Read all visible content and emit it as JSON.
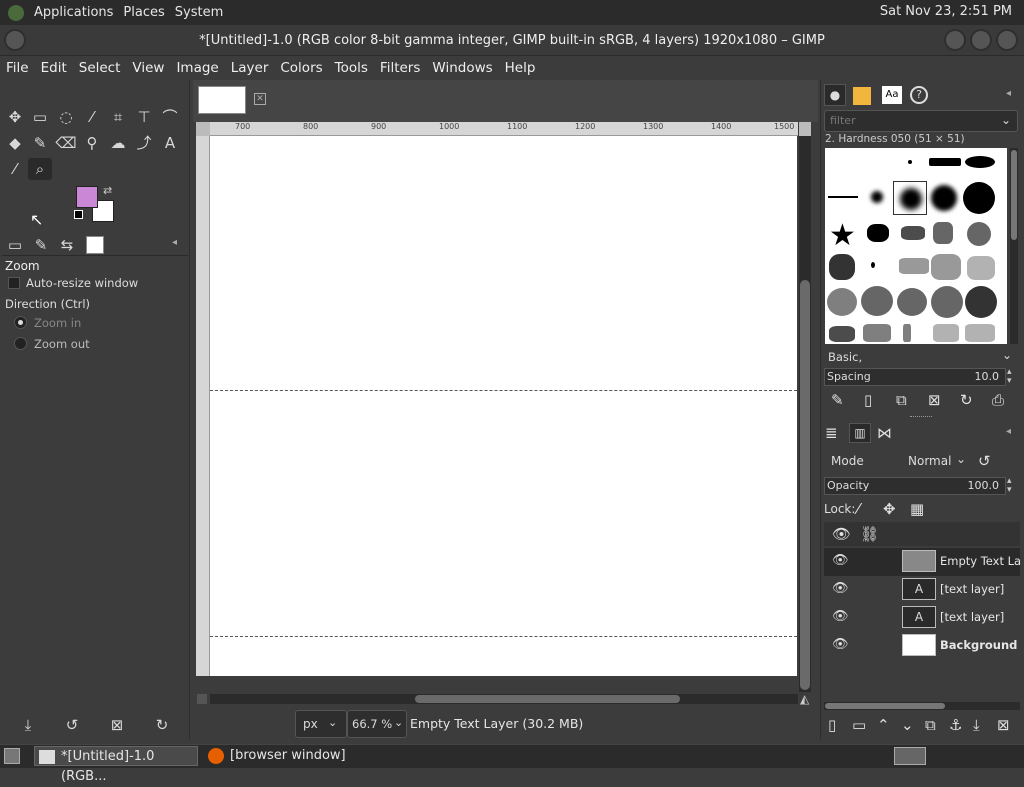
{
  "topbar": {
    "applications": "Applications",
    "places": "Places",
    "system": "System",
    "clock": "Sat Nov 23,  2:51 PM"
  },
  "window": {
    "title": "*[Untitled]-1.0 (RGB color 8-bit gamma integer, GIMP built-in sRGB, 4 layers) 1920x1080 – GIMP"
  },
  "menu": [
    "File",
    "Edit",
    "Select",
    "View",
    "Image",
    "Layer",
    "Colors",
    "Tools",
    "Filters",
    "Windows",
    "Help"
  ],
  "tool_options": {
    "title": "Zoom",
    "auto_resize": "Auto-resize window",
    "direction_label": "Direction  (Ctrl)",
    "zoom_in": "Zoom in",
    "zoom_out": "Zoom out"
  },
  "ruler_ticks": [
    "700",
    "800",
    "900",
    "1000",
    "1100",
    "1200",
    "1300",
    "1400",
    "1500"
  ],
  "statusbar": {
    "unit": "px",
    "zoom": "66.7 %",
    "message": "Empty Text Layer (30.2 MB)"
  },
  "brushes": {
    "filter_placeholder": "filter",
    "selected": "2. Hardness 050 (51 × 51)",
    "preset": "Basic,",
    "spacing_label": "Spacing",
    "spacing_value": "10.0"
  },
  "layers": {
    "mode_label": "Mode",
    "mode_value": "Normal",
    "opacity_label": "Opacity",
    "opacity_value": "100.0",
    "lock_label": "Lock:",
    "items": [
      {
        "name": "Empty Text Layer"
      },
      {
        "name": "[text layer]"
      },
      {
        "name": "[text layer]"
      },
      {
        "name": "Background"
      }
    ]
  },
  "taskbar": {
    "gimp": "*[Untitled]-1.0 (RGB...",
    "browser": "[browser window]"
  },
  "colors": {
    "fg": "#c987d6",
    "bg": "#ffffff"
  }
}
